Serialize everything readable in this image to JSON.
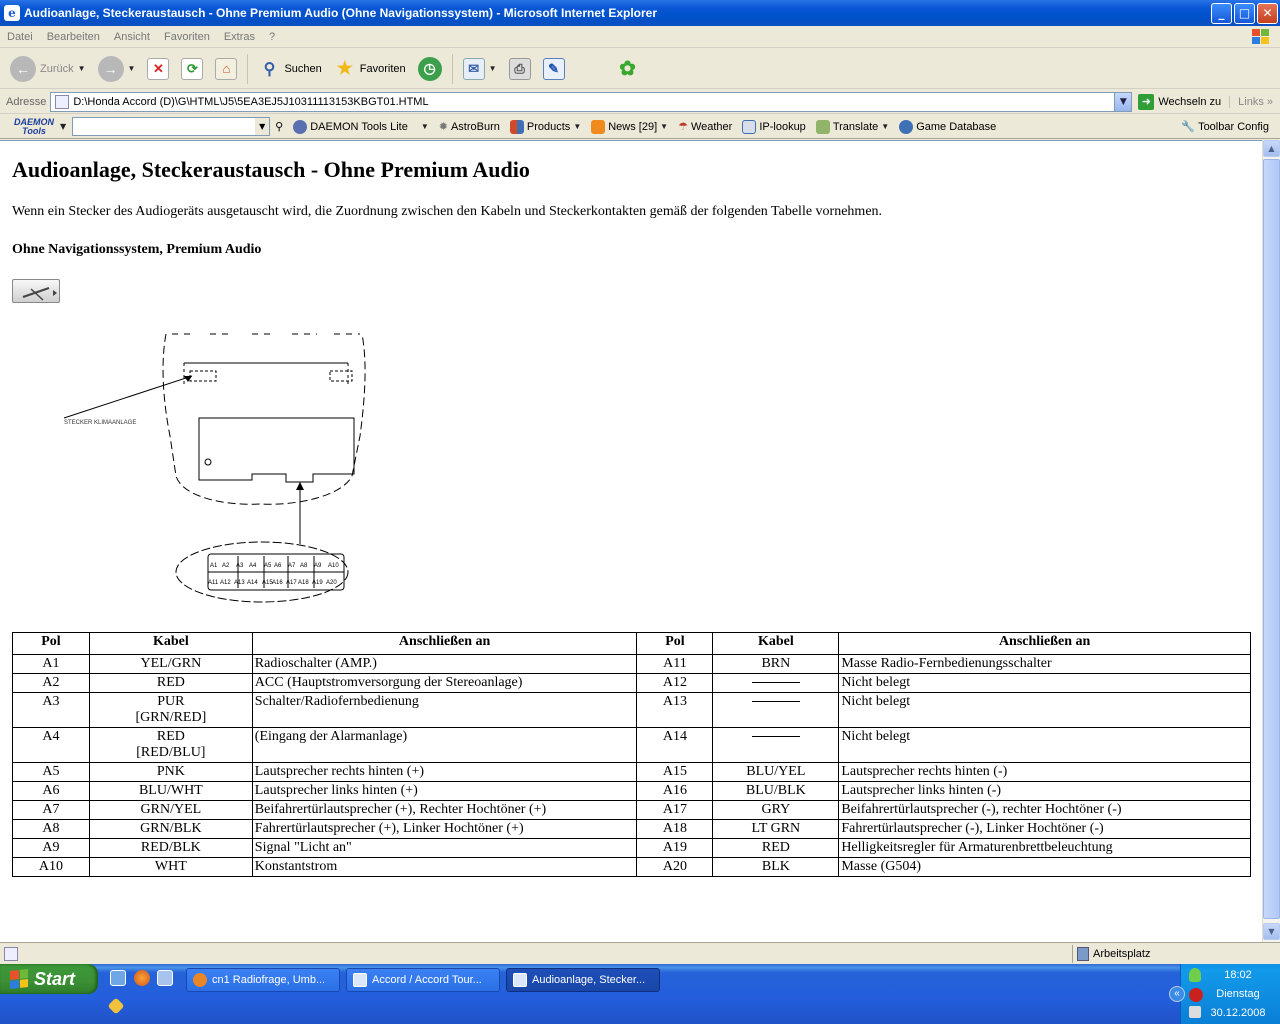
{
  "window": {
    "title": "Audioanlage, Steckeraustausch - Ohne Premium Audio (Ohne Navigationssystem) - Microsoft Internet Explorer",
    "controls": [
      "_",
      "□",
      "✕"
    ]
  },
  "menu": [
    "Datei",
    "Bearbeiten",
    "Ansicht",
    "Favoriten",
    "Extras",
    "?"
  ],
  "toolbar": {
    "back": "Zurück",
    "search": "Suchen",
    "favorites": "Favoriten"
  },
  "address": {
    "label": "Adresse",
    "value": "D:\\Honda Accord (D)\\G\\HTML\\J5\\5EA3EJ5J10311113153KBGT01.HTML",
    "go": "Wechseln zu",
    "links": "Links"
  },
  "daemon_toolbar": {
    "logo_line1": "DAEMON",
    "logo_line2": "Tools",
    "items": [
      {
        "label": "DAEMON Tools Lite",
        "icon": "daemon-icon",
        "color": "#5a6fb0"
      },
      {
        "label": "AstroBurn",
        "icon": "astroburn-icon",
        "color": "#888888"
      },
      {
        "label": "Products",
        "icon": "products-icon",
        "color": "#d04a2a"
      },
      {
        "label": "News [29]",
        "icon": "rss-icon",
        "color": "#f08a1c"
      },
      {
        "label": "Weather",
        "icon": "weather-icon",
        "color": "#c0392b"
      },
      {
        "label": "IP-lookup",
        "icon": "ip-lookup-icon",
        "color": "#3f6fb5"
      },
      {
        "label": "Translate",
        "icon": "translate-icon",
        "color": "#5a8f3a"
      },
      {
        "label": "Game Database",
        "icon": "game-database-icon",
        "color": "#3f6fb5"
      }
    ],
    "config": "Toolbar Config"
  },
  "page": {
    "heading": "Audioanlage, Steckeraustausch - Ohne Premium Audio",
    "intro": "Wenn ein Stecker des Audiogeräts ausgetauscht wird, die Zuordnung zwischen den Kabeln und Steckerkontakten gemäß der folgenden Tabelle vornehmen.",
    "subheading": "Ohne Navigationssystem, Premium Audio",
    "diagram_label": "STECKER KLIMAANLAGE",
    "connector_top": [
      "A1",
      "A2",
      "A3",
      "A4",
      "A5",
      "A6",
      "A7",
      "A8",
      "A9",
      "A10"
    ],
    "connector_bottom": [
      "A11",
      "A12",
      "A13",
      "A14",
      "A15",
      "A16",
      "A17",
      "A18",
      "A19",
      "A20"
    ],
    "table": {
      "headers": [
        "Pol",
        "Kabel",
        "Anschließen an",
        "Pol",
        "Kabel",
        "Anschließen an"
      ],
      "rows": [
        [
          "A1",
          "YEL/GRN",
          "Radioschalter (AMP.)",
          "A11",
          "BRN",
          "Masse Radio-Fernbedienungsschalter"
        ],
        [
          "A2",
          "RED",
          "ACC (Hauptstromversorgung der Stereoanlage)",
          "A12",
          "—",
          "Nicht belegt"
        ],
        [
          "A3",
          "PUR\n[GRN/RED]",
          "Schalter/Radiofernbedienung",
          "A13",
          "—",
          "Nicht belegt"
        ],
        [
          "A4",
          "RED\n[RED/BLU]",
          "(Eingang der Alarmanlage)",
          "A14",
          "—",
          "Nicht belegt"
        ],
        [
          "A5",
          "PNK",
          "Lautsprecher rechts hinten (+)",
          "A15",
          "BLU/YEL",
          "Lautsprecher rechts hinten (-)"
        ],
        [
          "A6",
          "BLU/WHT",
          "Lautsprecher links hinten (+)",
          "A16",
          "BLU/BLK",
          "Lautsprecher links hinten (-)"
        ],
        [
          "A7",
          "GRN/YEL",
          "Beifahrertürlautsprecher (+), Rechter Hochtöner (+)",
          "A17",
          "GRY",
          "Beifahrertürlautsprecher (-), rechter Hochtöner (-)"
        ],
        [
          "A8",
          "GRN/BLK",
          "Fahrertürlautsprecher (+), Linker Hochtöner (+)",
          "A18",
          "LT GRN",
          "Fahrertürlautsprecher (-), Linker Hochtöner (-)"
        ],
        [
          "A9",
          "RED/BLK",
          "Signal \"Licht an\"",
          "A19",
          "RED",
          "Helligkeitsregler für Armaturenbrettbeleuchtung"
        ],
        [
          "A10",
          "WHT",
          "Konstantstrom",
          "A20",
          "BLK",
          "Masse (G504)"
        ]
      ]
    }
  },
  "status": {
    "zone": "Arbeitsplatz"
  },
  "taskbar": {
    "start": "Start",
    "tasks": [
      {
        "label": "cn1 Radiofrage, Umb...",
        "active": false,
        "color": "#e9862a"
      },
      {
        "label": "Accord / Accord Tour...",
        "active": false,
        "color": "#4a8de8"
      },
      {
        "label": "Audioanlage, Stecker...",
        "active": true,
        "color": "#4a8de8"
      }
    ],
    "clock_time": "18:02",
    "clock_day": "Dienstag",
    "clock_date": "30.12.2008"
  },
  "colors": {
    "titlebar": "#0a57d6",
    "taskbar": "#245edc",
    "start": "#3c8f35"
  }
}
